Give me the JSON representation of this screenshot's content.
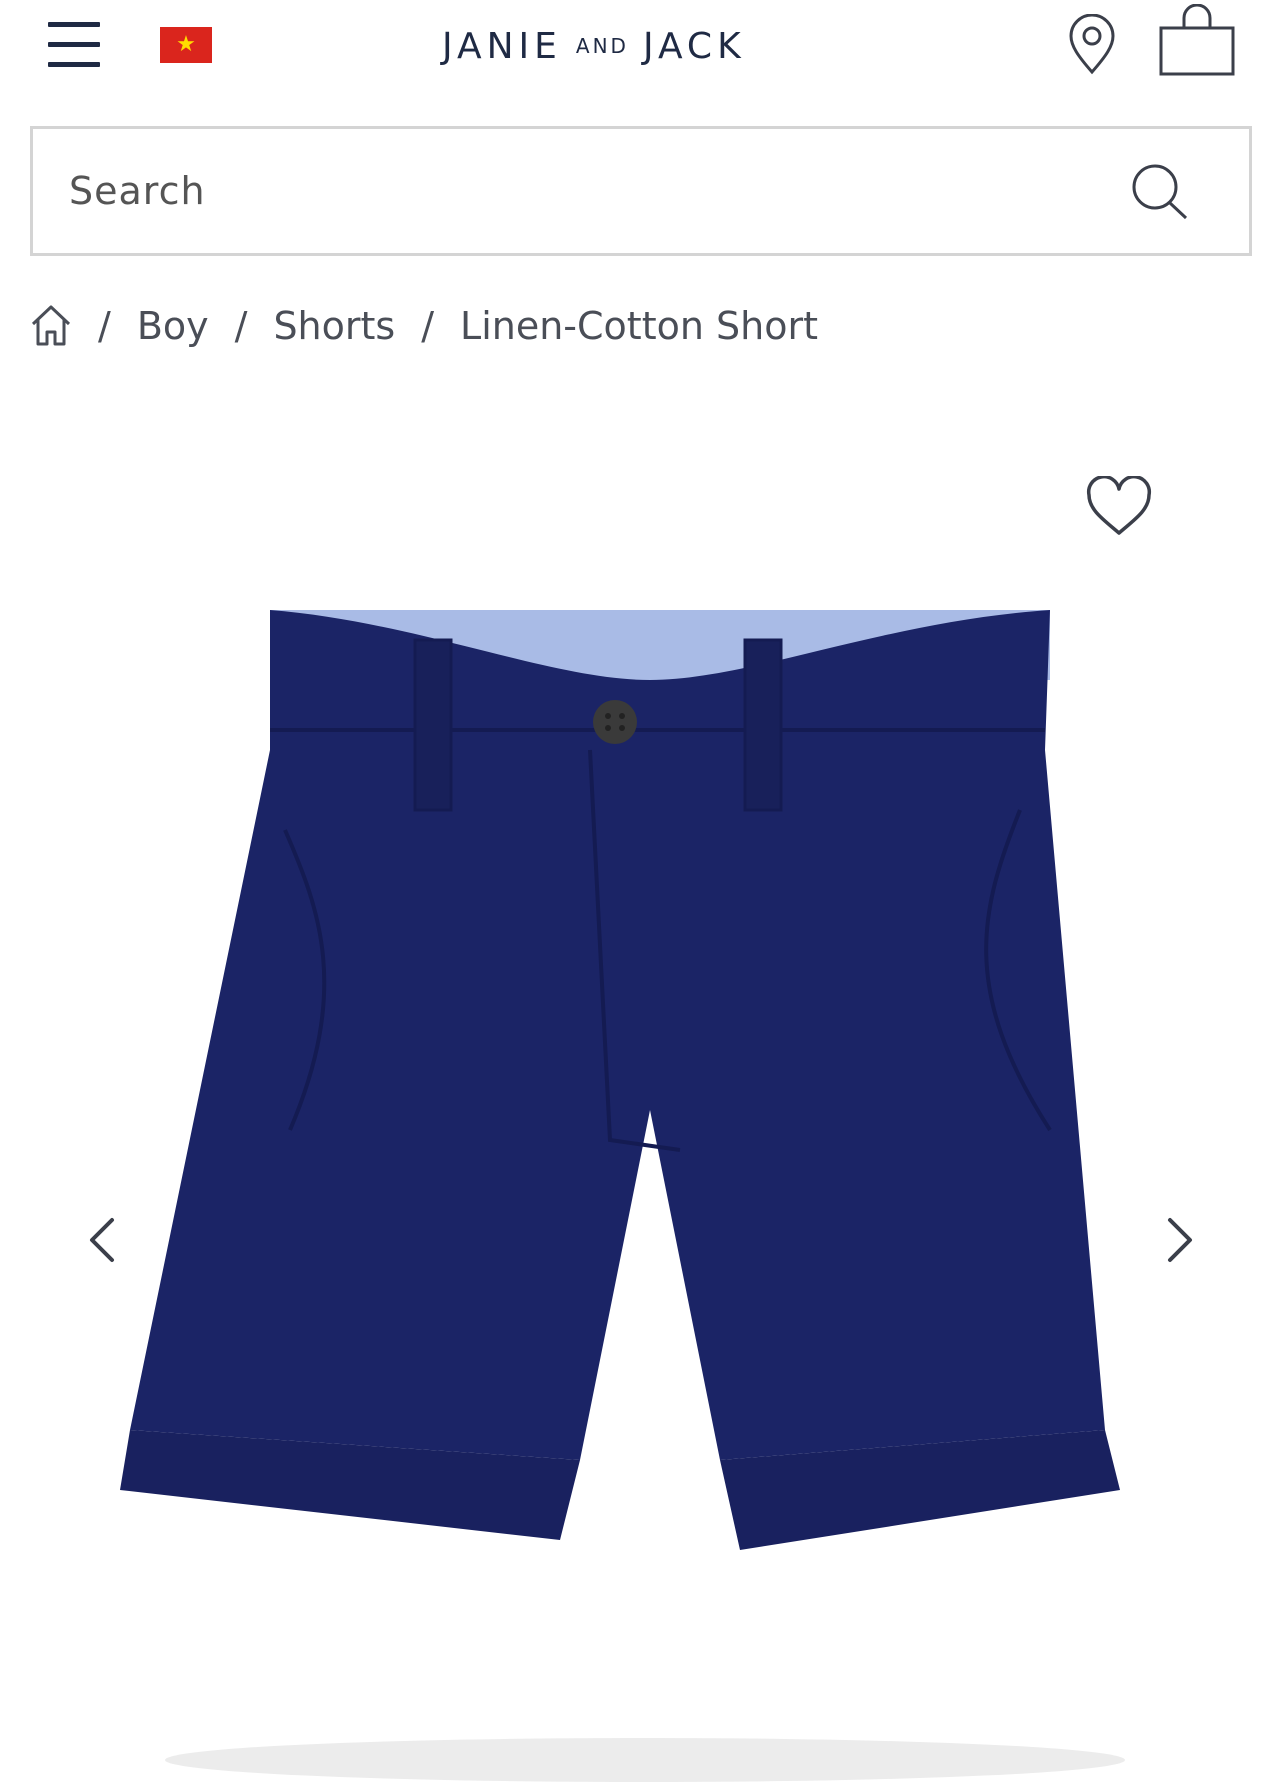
{
  "header": {
    "menu_icon": "hamburger-menu-icon",
    "flag_icon": "vietnam-flag-icon",
    "flag_colors": {
      "field": "#da251d",
      "star": "#ffdd00"
    },
    "logo": {
      "word1": "JANIE",
      "word2": "AND",
      "word3": "JACK"
    },
    "location_icon": "map-pin-icon",
    "bag_icon": "shopping-bag-icon",
    "brand_color": "#1f2a44"
  },
  "search": {
    "placeholder": "Search",
    "icon": "search-icon"
  },
  "breadcrumb": {
    "home_icon": "home-icon",
    "separator": "/",
    "items": [
      "Boy",
      "Shorts",
      "Linen-Cotton Short"
    ]
  },
  "product": {
    "wishlist_icon": "heart-icon",
    "prev_icon": "chevron-left-icon",
    "next_icon": "chevron-right-icon",
    "image_alt": "Navy linen-cotton shorts",
    "image_colors": {
      "fabric": "#1b2466",
      "lining": "#a9bbe6",
      "button": "#3a3a3a"
    }
  }
}
